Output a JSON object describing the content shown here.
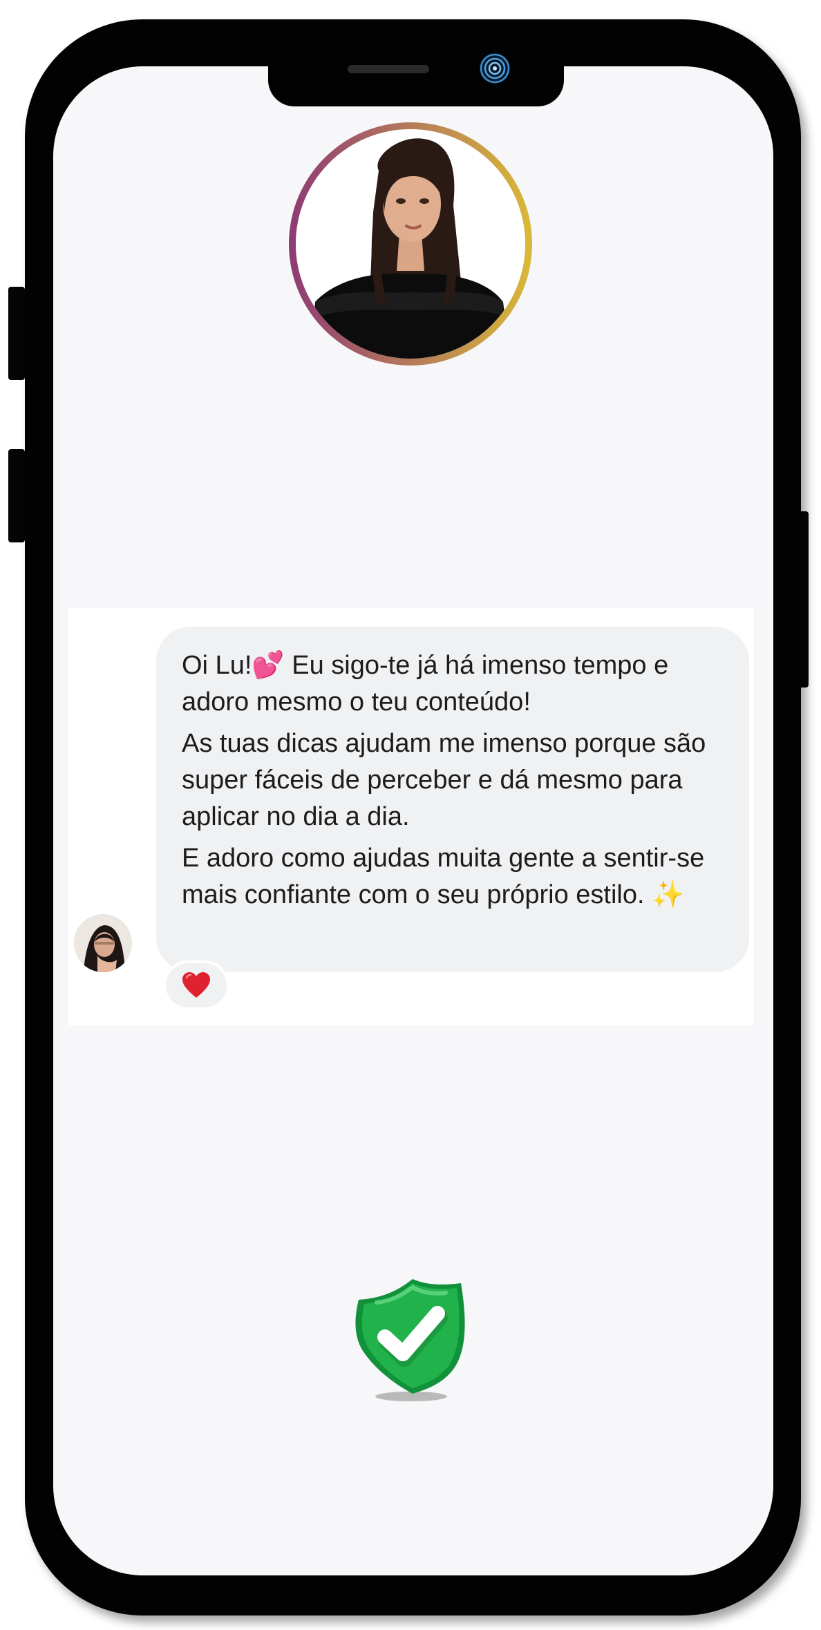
{
  "message": {
    "paragraphs": [
      "Oi Lu!💕 Eu sigo-te já há imenso tempo e adoro mesmo o teu conteúdo!",
      "As tuas dicas ajudam me imenso porque são super fáceis de perceber e dá mesmo para aplicar no dia a dia.",
      "E adoro como ajudas muita gente a sentir-se mais confiante com o seu próprio estilo. ✨"
    ],
    "reaction": "heart"
  },
  "colors": {
    "ring_start": "#8e3b73",
    "ring_end": "#d9b938",
    "bubble": "#f0f1f3",
    "verified_green": "#1fae4a"
  },
  "icons": {
    "camera": "camera-lens-icon",
    "reaction": "red-heart-icon",
    "verified": "verified-shield-check-icon"
  }
}
